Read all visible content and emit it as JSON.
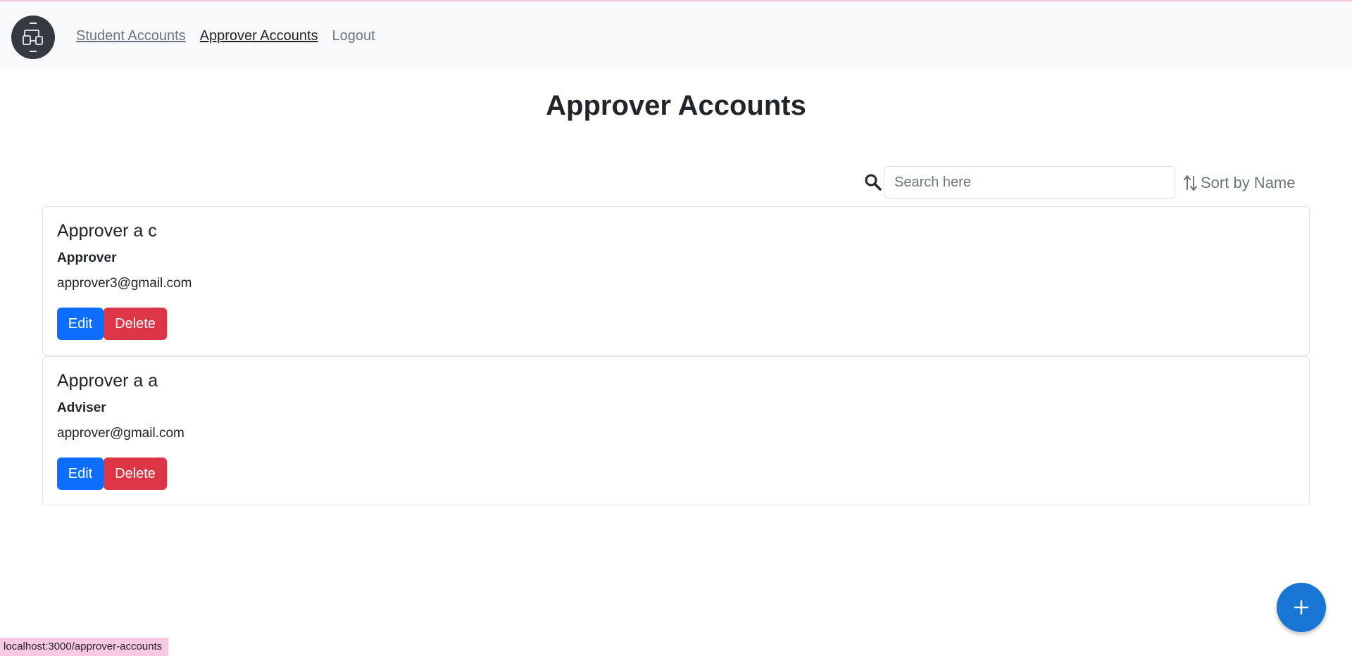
{
  "nav": {
    "links": [
      {
        "label": "Student Accounts"
      },
      {
        "label": "Approver Accounts"
      },
      {
        "label": "Logout"
      }
    ]
  },
  "page": {
    "title": "Approver Accounts"
  },
  "toolbar": {
    "search_placeholder": "Search here",
    "sort_label": "Sort by Name"
  },
  "accounts": [
    {
      "name": "Approver a c",
      "role": "Approver",
      "email": "approver3@gmail.com",
      "edit_label": "Edit",
      "delete_label": "Delete"
    },
    {
      "name": "Approver a a",
      "role": "Adviser",
      "email": "approver@gmail.com",
      "edit_label": "Edit",
      "delete_label": "Delete"
    }
  ],
  "fab": {
    "icon": "plus-icon"
  },
  "status_bar": {
    "url": "localhost:3000/approver-accounts"
  },
  "colors": {
    "primary": "#0d6efd",
    "danger": "#dc3545",
    "fab": "#1976d2",
    "navbar": "#f8f9fa",
    "logo": "#343a40"
  }
}
